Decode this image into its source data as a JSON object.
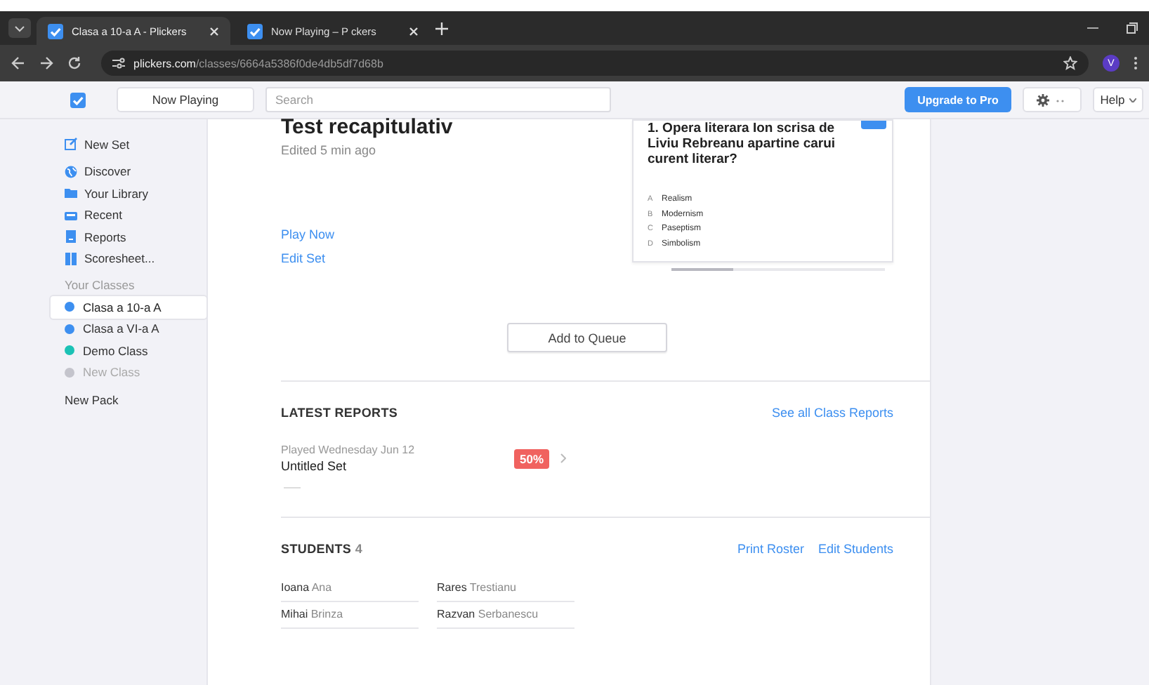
{
  "browser": {
    "tabs": [
      {
        "title": "Clasa a 10-a A - Plickers",
        "selected": true
      },
      {
        "title": "Now Playing – P ckers",
        "selected": false
      }
    ],
    "url_host": "plickers.com",
    "url_path": "/classes/6664a5386f0de4db5df7d68b",
    "profile": "V"
  },
  "topbar": {
    "now_playing": "Now Playing",
    "search": {
      "placeholder": "Search"
    },
    "upgrade": "Upgrade to Pro",
    "help": "Help"
  },
  "sidebar": {
    "items": [
      {
        "label": "New Set",
        "kind": "new"
      },
      {
        "label": "Discover",
        "kind": "globe"
      },
      {
        "label": "Your Library",
        "kind": "folder"
      },
      {
        "label": "Recent",
        "kind": "tray"
      },
      {
        "label": "Reports",
        "kind": "report"
      },
      {
        "label": "Scoresheet...",
        "kind": "columns"
      }
    ],
    "section": "Your Classes",
    "classes": [
      {
        "label": "Clasa a 10-a A",
        "color": "#3d8ff0",
        "selected": true,
        "disabled": false
      },
      {
        "label": "Clasa a VI-a A",
        "color": "#3d8ff0",
        "selected": false,
        "disabled": false
      },
      {
        "label": "Demo Class",
        "color": "#1bc2b5",
        "selected": false,
        "disabled": false
      },
      {
        "label": "New Class",
        "color": "#c4c4cc",
        "selected": false,
        "disabled": true
      }
    ],
    "new_pack": "New Pack"
  },
  "set": {
    "title": "Test recapitulativ",
    "edited": "Edited 5 min ago",
    "actions": [
      "Play Now",
      "Edit Set"
    ],
    "question": {
      "text": "1. Opera literara Ion scrisa de Liviu Rebreanu apartine carui curent literar?",
      "choices": [
        {
          "letter": "A",
          "text": "Realism"
        },
        {
          "letter": "B",
          "text": "Modernism"
        },
        {
          "letter": "C",
          "text": "Paseptism"
        },
        {
          "letter": "D",
          "text": "Simbolism"
        }
      ]
    },
    "add_to_queue": "Add to Queue"
  },
  "reports": {
    "heading": "LATEST REPORTS",
    "see_all": "See all Class Reports",
    "items": [
      {
        "played": "Played Wednesday Jun 12",
        "title": "Untitled Set",
        "score": "50%"
      }
    ]
  },
  "students": {
    "heading": "STUDENTS",
    "count": "4",
    "actions": [
      "Print Roster",
      "Edit Students"
    ],
    "list": [
      {
        "first": "Ioana",
        "last": "Ana"
      },
      {
        "first": "Rares",
        "last": "Trestianu"
      },
      {
        "first": "Mihai",
        "last": "Brinza"
      },
      {
        "first": "Razvan",
        "last": "Serbanescu"
      }
    ]
  }
}
